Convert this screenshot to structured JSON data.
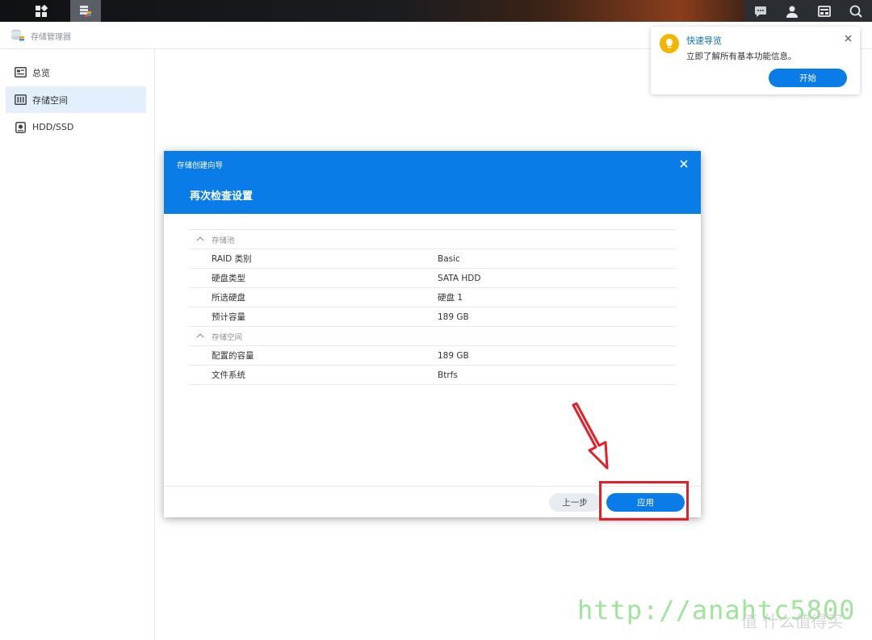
{
  "app": {
    "title": "存储管理器"
  },
  "sidebar": {
    "items": [
      {
        "label": "总览",
        "icon": "overview-icon"
      },
      {
        "label": "存储空间",
        "icon": "storage-icon",
        "active": true
      },
      {
        "label": "HDD/SSD",
        "icon": "disk-icon"
      }
    ]
  },
  "notification": {
    "title": "快速导览",
    "text": "立即了解所有基本功能信息。",
    "button": "开始"
  },
  "dialog": {
    "subtitle": "存储创建向导",
    "title": "再次检查设置",
    "sections": [
      {
        "label": "存储池",
        "rows": [
          {
            "key": "RAID 类别",
            "value": "Basic"
          },
          {
            "key": "硬盘类型",
            "value": "SATA HDD"
          },
          {
            "key": "所选硬盘",
            "value": "硬盘 1"
          },
          {
            "key": "预计容量",
            "value": "189 GB"
          }
        ]
      },
      {
        "label": "存储空间",
        "rows": [
          {
            "key": "配置的容量",
            "value": "189 GB"
          },
          {
            "key": "文件系统",
            "value": "Btrfs"
          }
        ]
      }
    ],
    "back_button": "上一步",
    "apply_button": "应用"
  },
  "watermark": {
    "url": "http://anahtc5800",
    "site": "值 什么值得买"
  },
  "colors": {
    "accent": "#0a7ce8",
    "highlight": "#e3202a",
    "bulb": "#f5b400",
    "watermark": "#8ee08a"
  }
}
